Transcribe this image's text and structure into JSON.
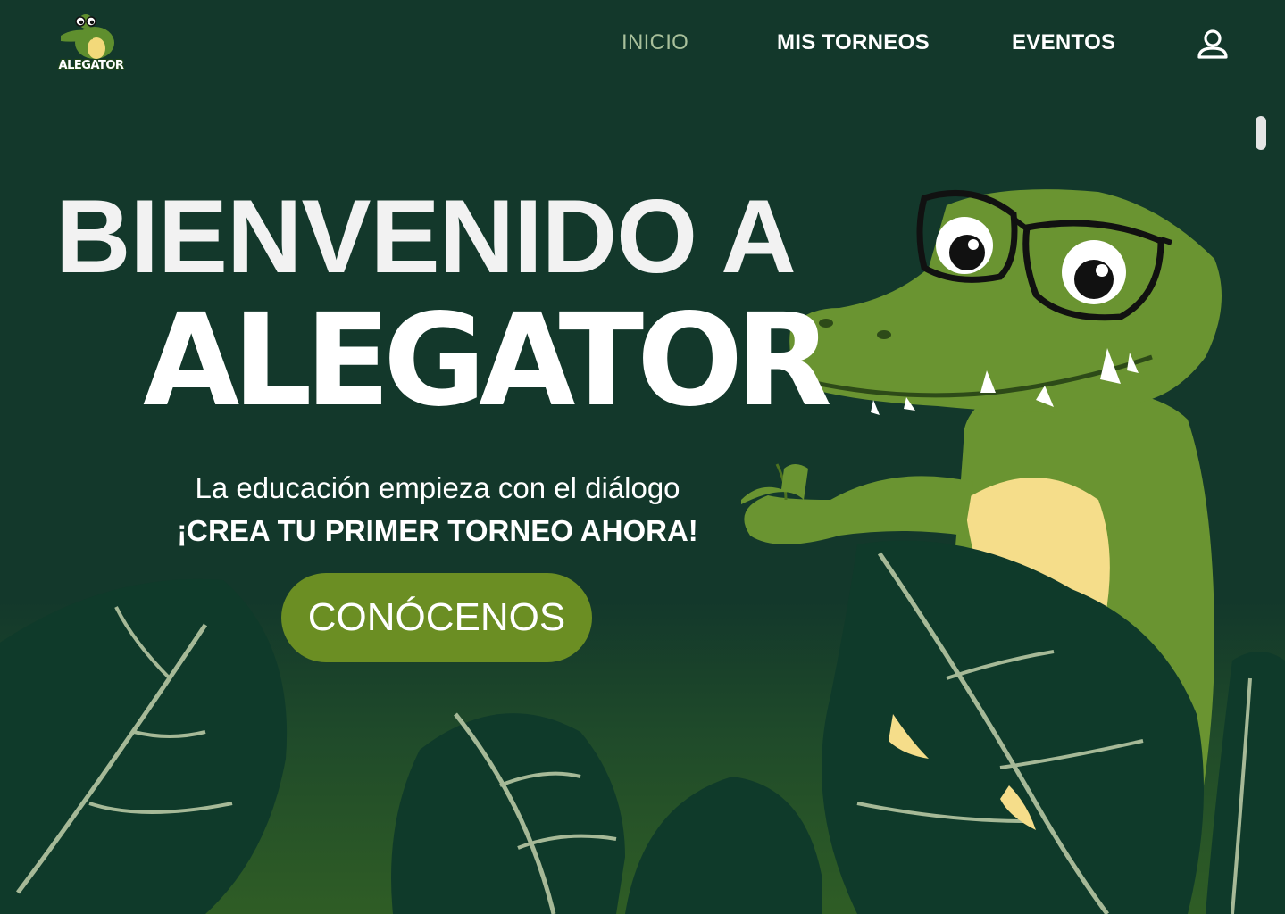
{
  "header": {
    "logo_text": "ALEGATOR",
    "nav": [
      {
        "label": "INICIO",
        "active": true
      },
      {
        "label": "MIS TORNEOS",
        "active": false
      },
      {
        "label": "EVENTOS",
        "active": false
      }
    ],
    "user_icon": "user-icon"
  },
  "hero": {
    "title_line1": "BIENVENIDO A",
    "title_line2": "ALEGATOR",
    "subtitle": "La educación empieza con el diálogo",
    "cta_text": "¡CREA TU PRIMER TORNEO AHORA!",
    "button_label": "CONÓCENOS"
  },
  "colors": {
    "background": "#13382b",
    "accent": "#6b8e23",
    "nav_active": "#a8c09b",
    "leaf_dark": "#0f3a2a",
    "croc_green": "#6a9431",
    "croc_belly": "#f5dd8a"
  }
}
